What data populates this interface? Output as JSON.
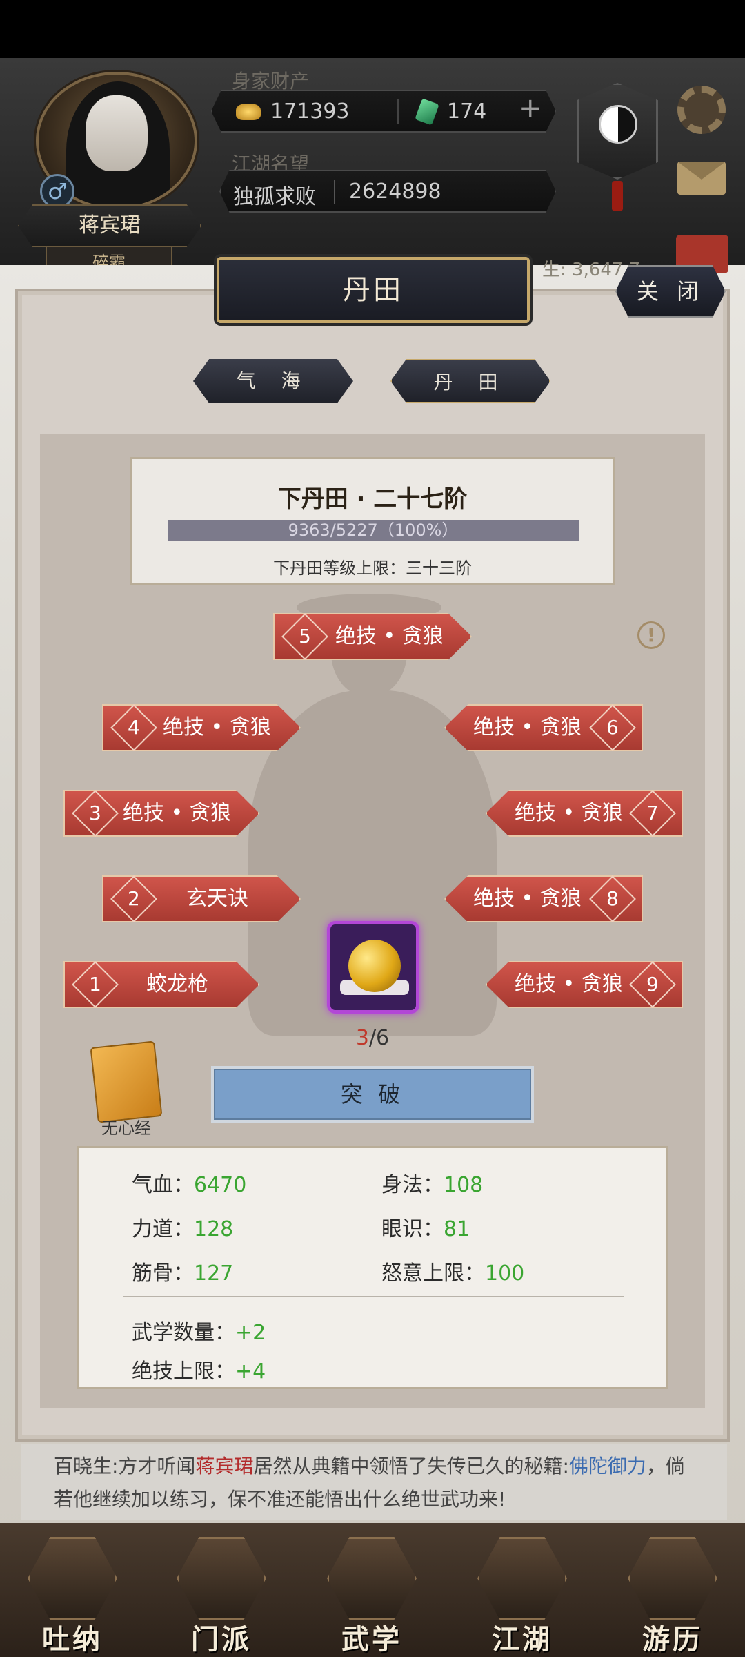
{
  "hud": {
    "wealth_label": "身家财产",
    "gold": "171393",
    "jade": "174",
    "plus": "+",
    "fame_label": "江湖名望",
    "fame_title": "独孤求败",
    "fame_value": "2624898",
    "player_name": "蒋宾珺",
    "player_title": "碎霸",
    "gender_symbol": "♂",
    "partial_stat": "生: 3,647,7"
  },
  "panel": {
    "title": "丹田",
    "close": "关 闭",
    "tabs": [
      "气 海",
      "丹 田"
    ],
    "level_title": "下丹田 · 二十七阶",
    "progress_text": "9363/5227（100%）",
    "progress_fraction": 1.0,
    "level_cap": "下丹田等级上限：三十三阶",
    "warn": "!"
  },
  "skills": [
    {
      "num": "1",
      "label": "蛟龙枪"
    },
    {
      "num": "2",
      "label": "玄天诀"
    },
    {
      "num": "3",
      "label": "绝技 • 贪狼"
    },
    {
      "num": "4",
      "label": "绝技 • 贪狼"
    },
    {
      "num": "5",
      "label": "绝技 • 贪狼"
    },
    {
      "num": "6",
      "label": "绝技 • 贪狼"
    },
    {
      "num": "7",
      "label": "绝技 • 贪狼"
    },
    {
      "num": "8",
      "label": "绝技 • 贪狼"
    },
    {
      "num": "9",
      "label": "绝技 • 贪狼"
    }
  ],
  "core": {
    "current": "3",
    "total": "/6"
  },
  "book": {
    "caption": "无心经"
  },
  "break_button": "突 破",
  "stats": {
    "qixue_label": "气血：",
    "qixue": "6470",
    "shenfa_label": "身法：",
    "shenfa": "108",
    "lidao_label": "力道：",
    "lidao": "128",
    "yanshi_label": "眼识：",
    "yanshi": "81",
    "jingu_label": "筋骨：",
    "jingu": "127",
    "nuyi_label": "怒意上限：",
    "nuyi": "100",
    "wuxue_label": "武学数量：",
    "wuxue": "+2",
    "jueji_label": "绝技上限：",
    "jueji": "+4"
  },
  "news": {
    "prefix": "百晓生:方才听闻",
    "name": "蒋宾珺",
    "middle": "居然从典籍中领悟了失传已久的秘籍:",
    "book": "佛陀御力",
    "suffix": "，倘若他继续加以练习，保不准还能悟出什么绝世武功来!"
  },
  "nav": [
    "吐纳",
    "门派",
    "武学",
    "江湖",
    "游历"
  ],
  "colors": {
    "accent_red": "#c0392b",
    "stat_green": "#3aa531",
    "core_purple": "#b247d6"
  }
}
